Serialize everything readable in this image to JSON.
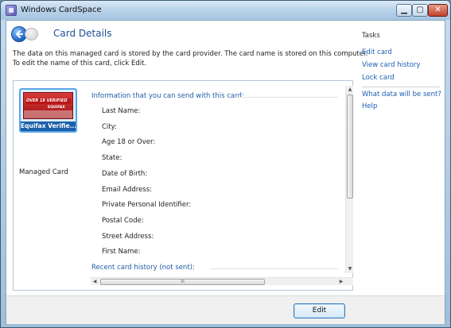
{
  "window": {
    "title": "Windows CardSpace",
    "controls": {
      "minimize": "▁",
      "maximize": "▢",
      "close": "✕"
    }
  },
  "header": {
    "back_icon": "back-arrow-icon",
    "title": "Card Details",
    "intro_line1": "The data on this managed card is stored by the card provider. The card name is stored on this computer.",
    "intro_line2": "To edit the name of this card, click Edit."
  },
  "card": {
    "badge_text": "OVER 18 VERIFIED",
    "brand": "EQUIFAX",
    "name": "Equifax Verifie...",
    "type": "Managed Card"
  },
  "info": {
    "heading": "Information that you can send with this card:",
    "fields": [
      "Last Name:",
      "City:",
      "Age 18 or Over:",
      "State:",
      "Date of Birth:",
      "Email Address:",
      "Private Personal Identifier:",
      "Postal Code:",
      "Street Address:",
      "First Name:"
    ],
    "history_heading": "Recent card history (not sent):"
  },
  "tasks": {
    "title": "Tasks",
    "links": [
      "Edit card",
      "View card history",
      "Lock card"
    ],
    "help_links": [
      "What data will be sent?",
      "Help"
    ]
  },
  "scrollbar": {
    "up": "▲",
    "down": "▼",
    "left": "◀",
    "right": "▶",
    "grip": "III"
  },
  "footer": {
    "edit_label": "Edit"
  },
  "colors": {
    "link": "#1b5fb5",
    "heading": "#1f5ca8",
    "card": "#c22020"
  }
}
